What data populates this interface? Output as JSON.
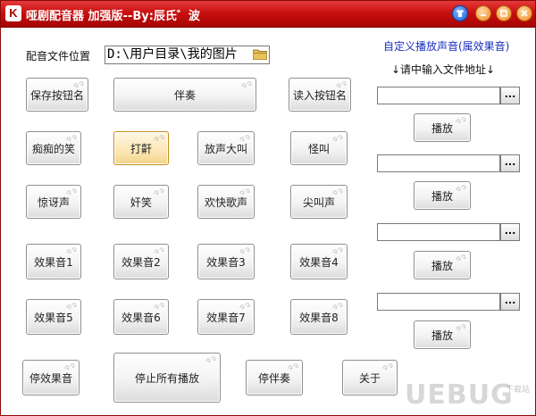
{
  "window": {
    "title": "哑剧配音器 加强版--By:辰氏゛波",
    "app_icon_letter": "K"
  },
  "path_label": "配音文件位置",
  "path_value": "D:\\用户目录\\我的图片",
  "buttons": {
    "save_names": "保存按钮名",
    "accompaniment": "伴奏",
    "load_names": "读入按钮名",
    "silly_laugh": "痴痴的笑",
    "snore": "打鼾",
    "cry_loud": "放声大叫",
    "weird_yell": "怪叫",
    "surprise": "惊讶声",
    "sly_laugh": "奸笑",
    "cheer_song": "欢快歌声",
    "scream": "尖叫声",
    "effect1": "效果音1",
    "effect2": "效果音2",
    "effect3": "效果音3",
    "effect4": "效果音4",
    "effect5": "效果音5",
    "effect6": "效果音6",
    "effect7": "效果音7",
    "effect8": "效果音8",
    "stop_effects": "停效果音",
    "stop_all": "停止所有播放",
    "stop_accompaniment": "停伴奏",
    "about": "关于"
  },
  "custom": {
    "title": "自定义播放声音(属效果音)",
    "hint": "↓请中输入文件地址↓",
    "slots": [
      {
        "value": "",
        "browse_label": "...",
        "play_label": "播放"
      },
      {
        "value": "",
        "browse_label": "...",
        "play_label": "播放"
      },
      {
        "value": "",
        "browse_label": "...",
        "play_label": "播放"
      },
      {
        "value": "",
        "browse_label": "...",
        "play_label": "播放"
      }
    ]
  },
  "watermark": {
    "text": "UEBUG",
    "small": "下载站"
  },
  "colors": {
    "titlebar": "#c81010",
    "heading_blue": "#1a2fbf",
    "selected_border": "#c88a1c"
  }
}
